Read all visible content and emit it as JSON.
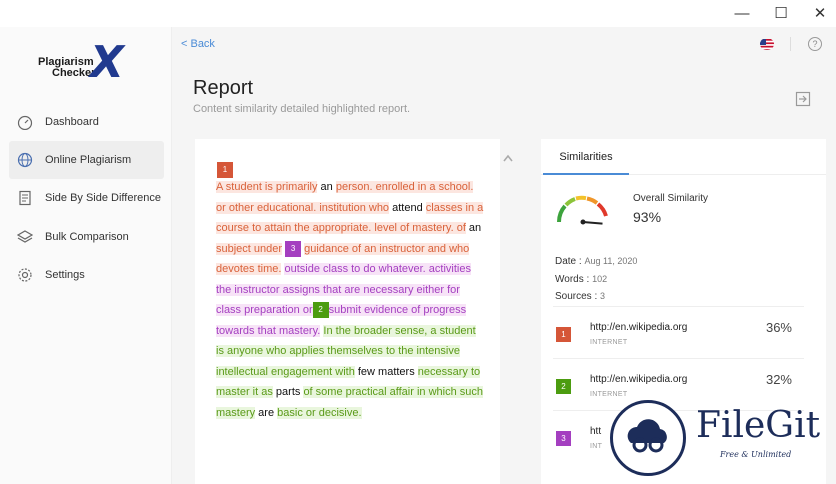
{
  "window": {
    "minimize": "—",
    "maximize": "☐",
    "close": "✕"
  },
  "logo": {
    "line1": "Plagiarism",
    "line2": "Checker",
    "mark": "X"
  },
  "sidebar": {
    "items": [
      {
        "label": "Dashboard",
        "icon": "dashboard-icon"
      },
      {
        "label": "Online Plagiarism",
        "icon": "globe-icon",
        "active": true
      },
      {
        "label": "Side By Side Difference",
        "icon": "document-icon"
      },
      {
        "label": "Bulk Comparison",
        "icon": "layers-icon"
      },
      {
        "label": "Settings",
        "icon": "gear-icon"
      }
    ]
  },
  "header": {
    "back": "< Back",
    "help": "?",
    "title": "Report",
    "subtitle": "Content similarity detailed highlighted report."
  },
  "report": {
    "badges": [
      "1",
      "3",
      "2"
    ],
    "segments": [
      "A student is primarily",
      " an ",
      "person. enrolled in a school. or other educational. institution who",
      " attend ",
      "classes in a course to attain the appropriate. level of mastery. of",
      " an ",
      "subject under",
      "guidance of an instructor and who devotes time.",
      " ",
      "outside class to do whatever. activities the instructor assigns that are necessary either for class preparation or",
      "submit evidence of progress towards that mastery.",
      " ",
      "In the broader sense, a student is anyone who applies themselves to the intensive intellectual engagement with",
      " few matters ",
      "necessary to master it as",
      " parts ",
      "of some practical affair in which such mastery",
      " are ",
      "basic or decisive."
    ]
  },
  "similarities": {
    "tab": "Similarities",
    "overall_label": "Overall Similarity",
    "overall_value": "93%",
    "overall_fraction": 0.93,
    "date_label": "Date :",
    "date_value": "Aug 11, 2020",
    "words_label": "Words :",
    "words_value": "102",
    "sources_label": "Sources :",
    "sources_value": "3",
    "sources": [
      {
        "n": "1",
        "url": "http://en.wikipedia.org",
        "type": "INTERNET",
        "pct": "36%",
        "color": "#d55638"
      },
      {
        "n": "2",
        "url": "http://en.wikipedia.org",
        "type": "INTERNET",
        "pct": "32%",
        "color": "#4c9c10"
      },
      {
        "n": "3",
        "url": "htt",
        "type": "INT",
        "pct": "",
        "color": "#a43fc0"
      }
    ]
  },
  "watermark": {
    "name": "FileGit",
    "tagline": "Free & Unlimited"
  }
}
